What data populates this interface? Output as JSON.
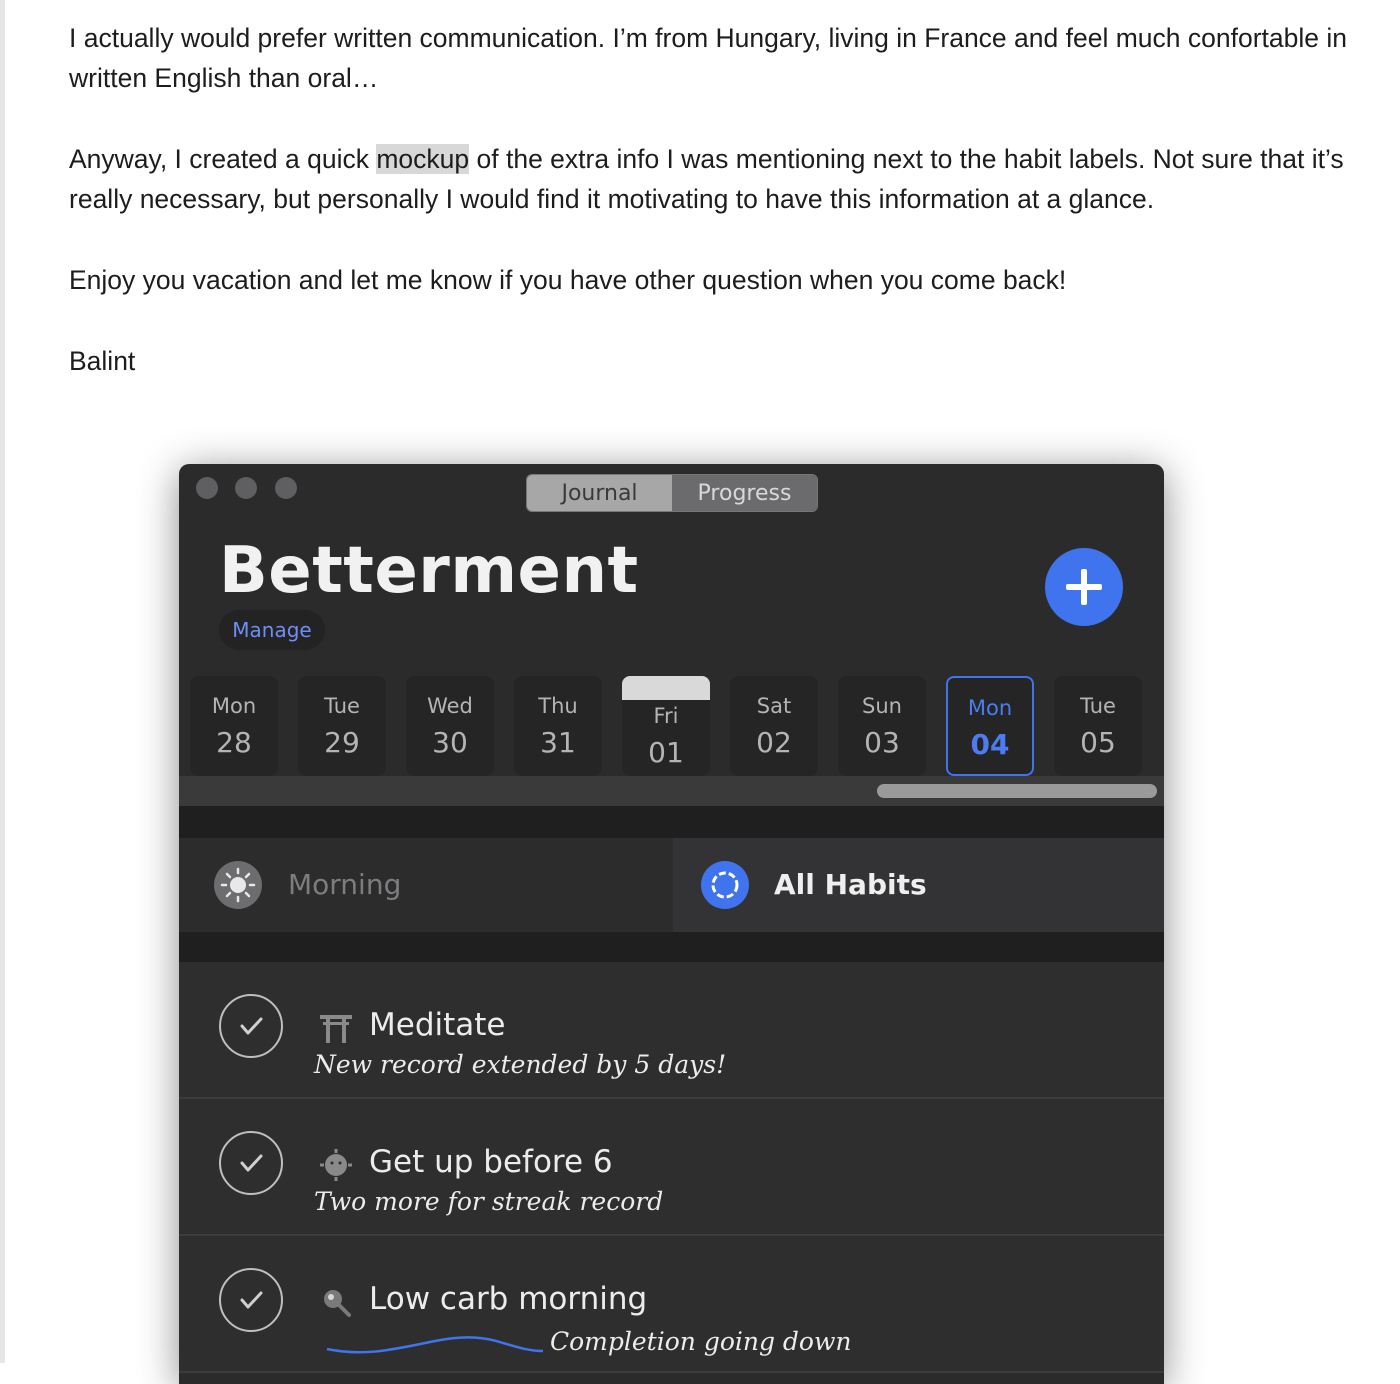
{
  "email": {
    "p1": "I actually would prefer written communication. I’m from Hungary, living in France and feel much confortable in written English than oral…",
    "p2_before": "Anyway, I created a quick ",
    "p2_highlight": "mockup",
    "p2_after": " of the extra info I was mentioning next to the habit labels. Not sure that it’s really necessary, but personally I would find it motivating to have this information at a glance.",
    "p3": "Enjoy you vacation and let me know if you have other question when you come back!",
    "signature": "Balint"
  },
  "app": {
    "tabs": {
      "journal": "Journal",
      "progress": "Progress",
      "active": "Journal"
    },
    "title": "Betterment",
    "manage_label": "Manage",
    "days": [
      {
        "name": "Mon",
        "date": "28"
      },
      {
        "name": "Tue",
        "date": "29"
      },
      {
        "name": "Wed",
        "date": "30"
      },
      {
        "name": "Thu",
        "date": "31"
      },
      {
        "name": "Fri",
        "date": "01"
      },
      {
        "name": "Sat",
        "date": "02"
      },
      {
        "name": "Sun",
        "date": "03"
      },
      {
        "name": "Mon",
        "date": "04"
      },
      {
        "name": "Tue",
        "date": "05"
      }
    ],
    "selected_day_index": 7,
    "filters": {
      "morning": "Morning",
      "all_habits": "All Habits",
      "active": "All Habits"
    },
    "habits": [
      {
        "icon": "torii-gate-icon",
        "name": "Meditate",
        "subtitle": "New record extended by 5 days!"
      },
      {
        "icon": "sun-emoji-icon",
        "name": "Get up before 6",
        "subtitle": "Two more for streak record"
      },
      {
        "icon": "magnifier-icon",
        "name": "Low carb morning",
        "subtitle": "Completion going down"
      }
    ],
    "colors": {
      "accent": "#3f74ee",
      "window_bg": "#2b2b2c"
    }
  }
}
